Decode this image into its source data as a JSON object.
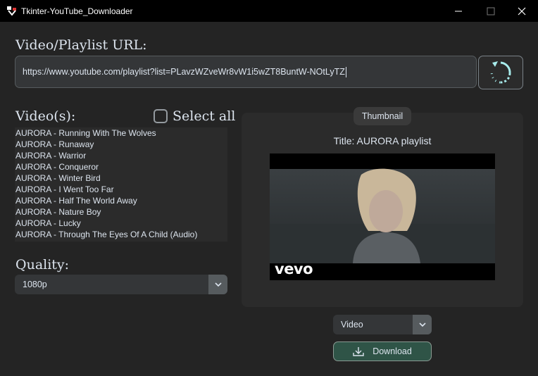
{
  "window": {
    "title": "Tkinter-YouTube_Downloader"
  },
  "url_section": {
    "label": "Video/Playlist URL:",
    "value": "https://www.youtube.com/playlist?list=PLavzWZveWr8vW1i5wZT8BuntW-NOtLyTZ"
  },
  "videos": {
    "label": "Video(s):",
    "select_all_label": "Select all",
    "items": [
      "AURORA - Running With The Wolves",
      "AURORA - Runaway",
      "AURORA - Warrior",
      "AURORA - Conqueror",
      "AURORA - Winter Bird",
      "AURORA - I Went Too Far",
      "AURORA - Half The World Away",
      "AURORA - Nature Boy",
      "AURORA - Lucky",
      "AURORA - Through The Eyes Of A Child (Audio)"
    ]
  },
  "quality": {
    "label": "Quality:",
    "selected": "1080p"
  },
  "thumbnail": {
    "label": "Thumbnail",
    "title": "Title: AURORA playlist",
    "watermark": "vevo"
  },
  "download": {
    "type_selected": "Video",
    "button_label": "Download"
  },
  "colors": {
    "background": "#242424",
    "titlebar": "#000000",
    "download_button": "#2f5447",
    "field": "#343638"
  },
  "icons": [
    "app-icon",
    "minimize-icon",
    "maximize-icon",
    "close-icon",
    "refresh-icon",
    "chevron-down-icon",
    "download-icon"
  ]
}
